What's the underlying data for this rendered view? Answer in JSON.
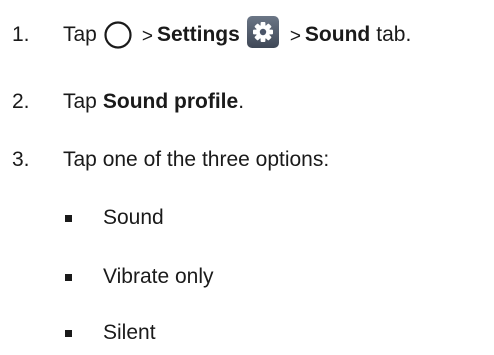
{
  "steps": [
    {
      "number": "1.",
      "parts": {
        "tap": "Tap",
        "sep1": ">",
        "settings": "Settings",
        "sep2": ">",
        "sound": "Sound",
        "suffix": "tab."
      },
      "icons": [
        "home-circle-icon",
        "settings-gear-icon"
      ]
    },
    {
      "number": "2.",
      "parts": {
        "tap": "Tap",
        "target": "Sound profile",
        "suffix": "."
      }
    },
    {
      "number": "3.",
      "text": "Tap one of the three options:"
    }
  ],
  "options": [
    "Sound",
    "Vibrate only",
    "Silent"
  ],
  "colors": {
    "text": "#1a1a1a",
    "settings_icon_bg": "#4a5568"
  }
}
